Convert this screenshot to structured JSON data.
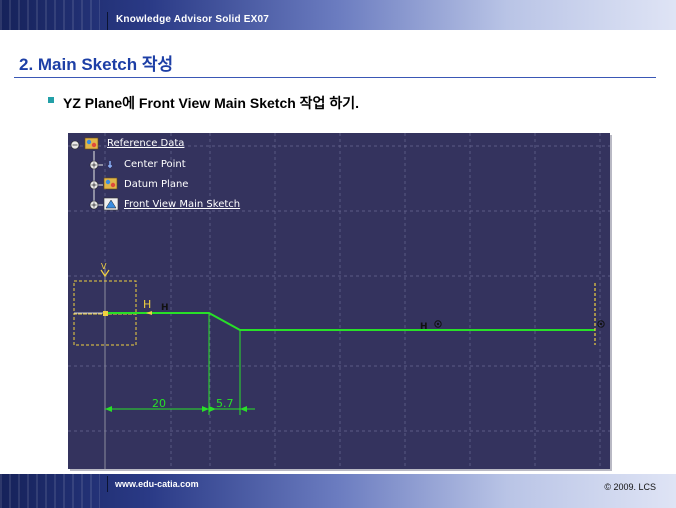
{
  "header": {
    "title": "Knowledge Advisor Solid EX07"
  },
  "slide": {
    "title": "2. Main Sketch 작성",
    "bullet": "YZ Plane에 Front View Main Sketch 작업 하기."
  },
  "tree": {
    "items": [
      {
        "label": "Reference Data"
      },
      {
        "label": "Center Point"
      },
      {
        "label": "Datum Plane"
      },
      {
        "label": "Front View Main Sketch"
      }
    ]
  },
  "sketch": {
    "constraint_h": "H",
    "axis_v": "V",
    "dimensions": [
      "20",
      "5.7"
    ]
  },
  "footer": {
    "url": "www.edu-catia.com",
    "copyright": "© 2009. LCS"
  },
  "colors": {
    "viewport_bg": "#34335e",
    "sketch_green": "#28e028",
    "title_blue": "#1d3fa6",
    "bullet_teal": "#23a0a8"
  }
}
